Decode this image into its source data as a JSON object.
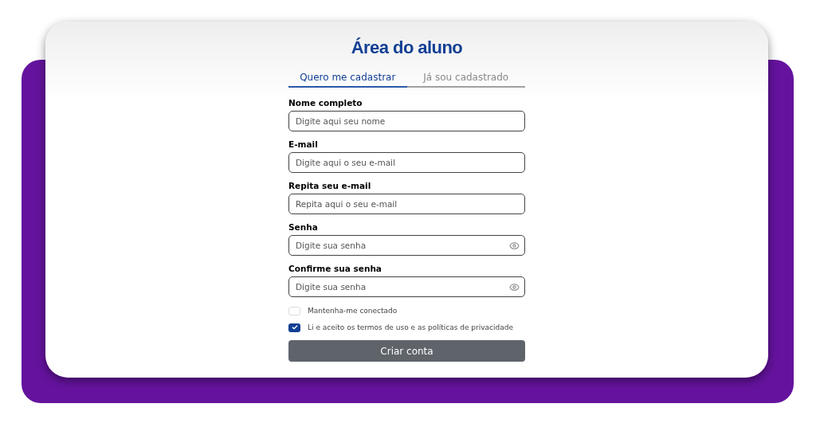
{
  "title": "Área do aluno",
  "tabs": [
    {
      "label": "Quero me cadastrar",
      "selected": true
    },
    {
      "label": "Já sou cadastrado",
      "selected": false
    }
  ],
  "fields": [
    {
      "label": "Nome completo",
      "placeholder": "Digite aqui seu nome",
      "kind": "text"
    },
    {
      "label": "E-mail",
      "placeholder": "Digite aqui o seu e-mail",
      "kind": "text"
    },
    {
      "label": "Repita seu e-mail",
      "placeholder": "Repita aqui o seu e-mail",
      "kind": "text"
    },
    {
      "label": "Senha",
      "placeholder": "Digite sua senha",
      "kind": "password"
    },
    {
      "label": "Confirme sua senha",
      "placeholder": "Digite sua senha",
      "kind": "password"
    }
  ],
  "checkboxes": [
    {
      "label": "Mantenha-me conectado",
      "checked": false
    },
    {
      "label": "Li e aceito os termos de uso e as políticas de privacidade",
      "checked": true
    }
  ],
  "submit": "Criar conta"
}
